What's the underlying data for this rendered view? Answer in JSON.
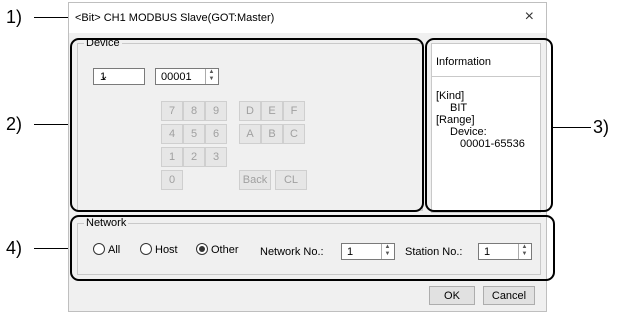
{
  "callouts": [
    "1)",
    "2)",
    "3)",
    "4)"
  ],
  "dialog": {
    "title": "<Bit> CH1 MODBUS Slave(GOT:Master)",
    "close": "×"
  },
  "device": {
    "legend": "Device",
    "type_value": "1",
    "address_value": "00001",
    "keys_row1": [
      "7",
      "8",
      "9",
      "D",
      "E",
      "F"
    ],
    "keys_row2": [
      "4",
      "5",
      "6",
      "A",
      "B",
      "C"
    ],
    "keys_row3": [
      "1",
      "2",
      "3"
    ],
    "key_zero": "0",
    "key_back": "Back",
    "key_clear": "CL"
  },
  "information": {
    "heading": "Information",
    "kind_label": "[Kind]",
    "kind_value": "BIT",
    "range_label": "[Range]",
    "range_device_label": "Device:",
    "range_value": "00001-65536"
  },
  "network": {
    "legend": "Network",
    "options": [
      "All",
      "Host",
      "Other"
    ],
    "selected": "Other",
    "network_no_label": "Network No.:",
    "network_no_value": "1",
    "station_no_label": "Station No.:",
    "station_no_value": "1"
  },
  "buttons": {
    "ok": "OK",
    "cancel": "Cancel"
  }
}
